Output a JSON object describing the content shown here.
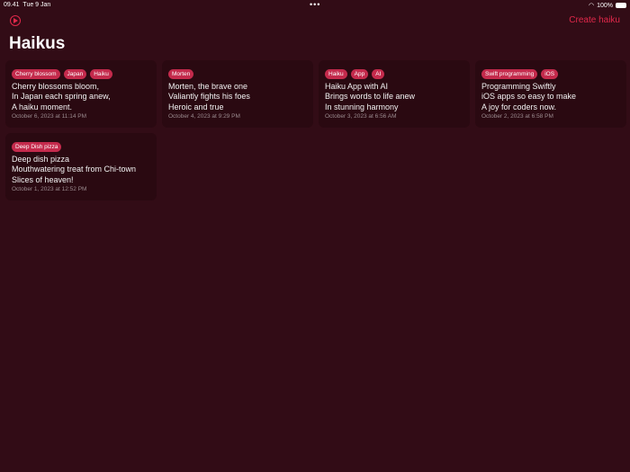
{
  "status": {
    "time": "09.41",
    "date": "Tue 9 Jan",
    "battery": "100%"
  },
  "header": {
    "title": "Haikus",
    "create_label": "Create haiku"
  },
  "haikus": [
    {
      "tags": [
        "Cherry blossom",
        "Japan",
        "Haiku"
      ],
      "lines": [
        "Cherry blossoms bloom,",
        "In Japan each spring anew,",
        "A haiku moment."
      ],
      "date": "October 6, 2023 at 11:14 PM"
    },
    {
      "tags": [
        "Morten"
      ],
      "lines": [
        "Morten, the brave one",
        "Valiantly fights his foes",
        "Heroic and true"
      ],
      "date": "October 4, 2023 at 9:29 PM"
    },
    {
      "tags": [
        "Haiku",
        "App",
        "AI"
      ],
      "lines": [
        "Haiku App with AI",
        "Brings words to life anew",
        "In stunning harmony"
      ],
      "date": "October 3, 2023 at 6:56 AM"
    },
    {
      "tags": [
        "Swift programming",
        "iOS"
      ],
      "lines": [
        "Programming Swiftly",
        "iOS apps so easy to make",
        "A joy for coders now."
      ],
      "date": "October 2, 2023 at 6:58 PM"
    },
    {
      "tags": [
        "Deep Dish pizza"
      ],
      "lines": [
        "Deep dish pizza",
        "Mouthwatering treat from Chi-town",
        "Slices of heaven!"
      ],
      "date": "October 1, 2023 at 12:52 PM"
    }
  ]
}
